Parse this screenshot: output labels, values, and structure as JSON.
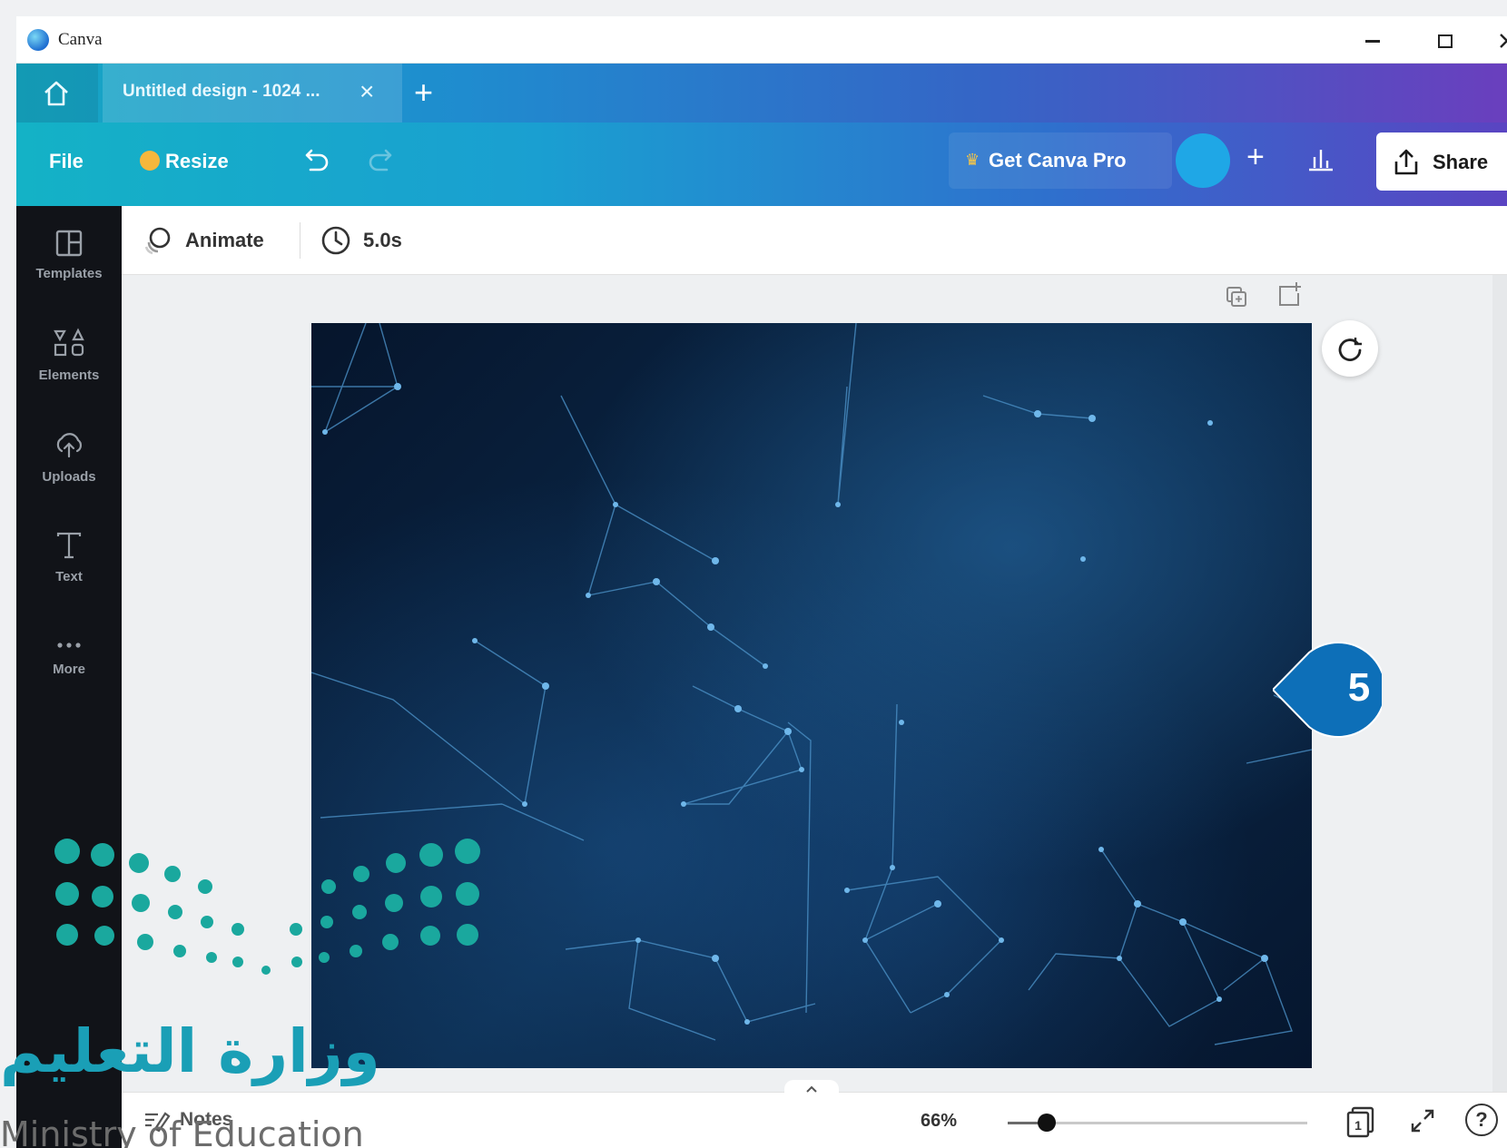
{
  "window": {
    "app_name": "Canva",
    "icon": "canva-logo",
    "controls": [
      "minimize-icon",
      "maximize-icon",
      "close-icon"
    ]
  },
  "tabs": {
    "home_icon": "home-icon",
    "active_tab_title": "Untitled design - 1024 ...",
    "close_glyph": "×",
    "new_tab_glyph": "+"
  },
  "toolbar": {
    "file_label": "File",
    "resize_label": "Resize",
    "pro_label": "Get Canva Pro",
    "add_glyph": "+",
    "share_label": "Share",
    "icons": [
      "undo-icon",
      "redo-icon",
      "crown-icon",
      "avatar",
      "stats-icon",
      "share-icon"
    ]
  },
  "sidebar": {
    "items": [
      {
        "label": "Templates",
        "icon": "templates-icon"
      },
      {
        "label": "Elements",
        "icon": "elements-icon"
      },
      {
        "label": "Uploads",
        "icon": "uploads-icon"
      },
      {
        "label": "Text",
        "icon": "text-icon"
      },
      {
        "label": "More",
        "icon": "more-icon"
      }
    ]
  },
  "animbar": {
    "animate_label": "Animate",
    "duration_label": "5.0s"
  },
  "canvas": {
    "callout_number": "5",
    "callout_color": "#0d6fb8"
  },
  "statusbar": {
    "notes_label": "Notes",
    "zoom_label": "66%",
    "zoom_level_percent": 13,
    "page_count": "1",
    "help_glyph": "?"
  },
  "watermark": {
    "arabic": "وزارة التعليم",
    "english": "Ministry of Education"
  },
  "colors": {
    "toolbar_gradient_start": "#14b2c6",
    "toolbar_gradient_end": "#5a44c2",
    "sidebar_bg": "#111318",
    "accent_teal": "#1aa89e"
  }
}
